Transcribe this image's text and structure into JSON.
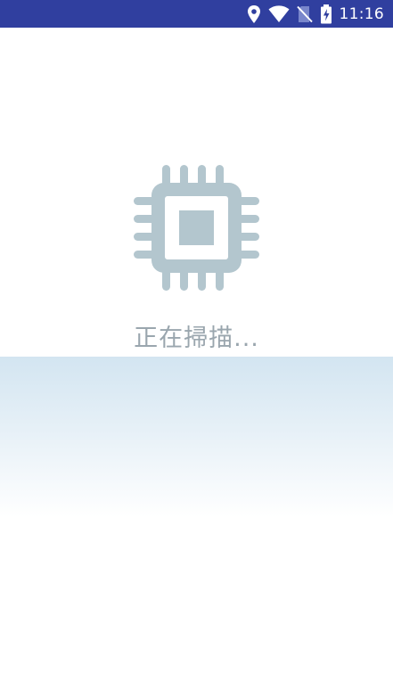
{
  "status_bar": {
    "time": "11:16",
    "icons": [
      "location-icon",
      "wifi-icon",
      "no-sim-icon",
      "battery-charging-icon"
    ],
    "background_color": "#303f9f"
  },
  "main": {
    "icon": "cpu-chip-icon",
    "icon_color": "#b3c6ce",
    "status_text": "正在掃描..."
  }
}
